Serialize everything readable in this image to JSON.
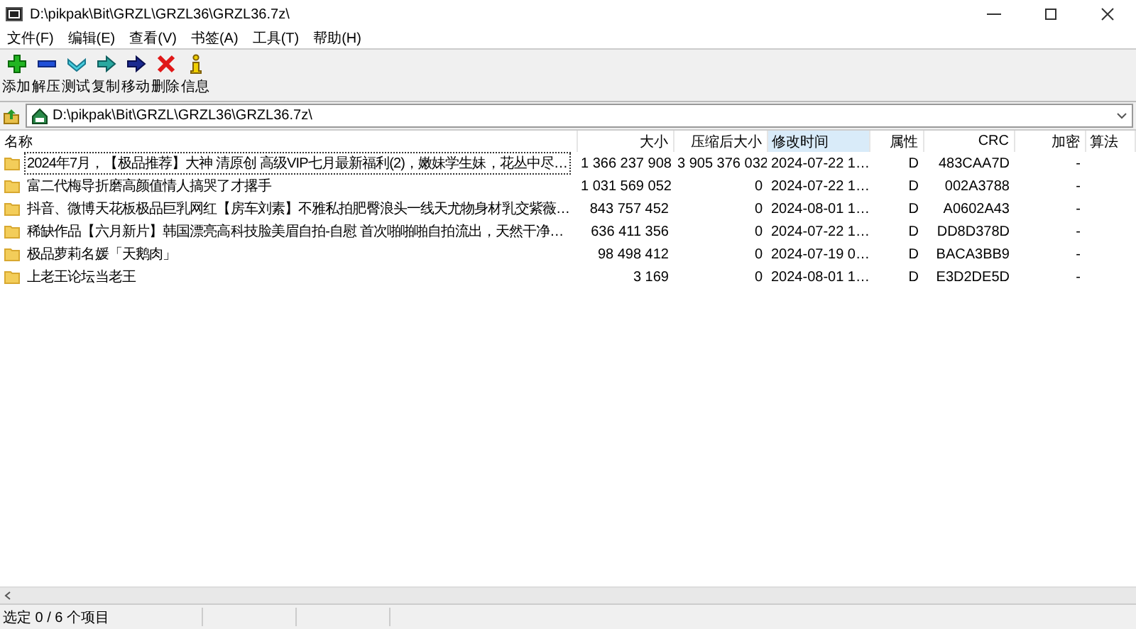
{
  "window": {
    "title": "D:\\pikpak\\Bit\\GRZL\\GRZL36\\GRZL36.7z\\"
  },
  "menu": [
    "文件(F)",
    "编辑(E)",
    "查看(V)",
    "书签(A)",
    "工具(T)",
    "帮助(H)"
  ],
  "toolbar": [
    {
      "kind": "add",
      "label": "添加"
    },
    {
      "kind": "extract",
      "label": "解压"
    },
    {
      "kind": "test",
      "label": "测试"
    },
    {
      "kind": "copy",
      "label": "复制"
    },
    {
      "kind": "move",
      "label": "移动"
    },
    {
      "kind": "delete",
      "label": "删除"
    },
    {
      "kind": "info",
      "label": "信息"
    }
  ],
  "address": {
    "path": "D:\\pikpak\\Bit\\GRZL\\GRZL36\\GRZL36.7z\\"
  },
  "table": {
    "columns": [
      {
        "label": "名称",
        "sorted": false
      },
      {
        "label": "大小",
        "sorted": false
      },
      {
        "label": "压缩后大小",
        "sorted": false
      },
      {
        "label": "修改时间",
        "sorted": true
      },
      {
        "label": "属性",
        "sorted": false
      },
      {
        "label": "CRC",
        "sorted": false
      },
      {
        "label": "加密",
        "sorted": false
      },
      {
        "label": "算法",
        "sorted": false
      }
    ],
    "rows": [
      {
        "focused": true,
        "cells": [
          "2024年7月，【极品推荐】大神 清原创 高级VIP七月最新福利(2)，嫩妹学生妹，花丛中尽…",
          "1 366 237 908",
          "3 905 376 032",
          "2024-07-22 1…",
          "D",
          "483CAA7D",
          "-"
        ]
      },
      {
        "focused": false,
        "cells": [
          "富二代梅导折磨高颜值情人搞哭了才撂手",
          "1 031 569 052",
          "0",
          "2024-07-22 1…",
          "D",
          "002A3788",
          "-"
        ]
      },
      {
        "focused": false,
        "cells": [
          "抖音、微博天花板极品巨乳网红【房车刘素】不雅私拍肥臀浪头一线天尤物身材乳交紫薇…",
          "843 757 452",
          "0",
          "2024-08-01 1…",
          "D",
          "A0602A43",
          "-"
        ]
      },
      {
        "focused": false,
        "cells": [
          "稀缺作品【六月新片】韩国漂亮高科技脸美眉自拍-自慰 首次啪啪啪自拍流出，天然干净…",
          "636 411 356",
          "0",
          "2024-07-22 1…",
          "D",
          "DD8D378D",
          "-"
        ]
      },
      {
        "focused": false,
        "cells": [
          "极品萝莉名媛「天鹅肉」",
          "98 498 412",
          "0",
          "2024-07-19 0…",
          "D",
          "BACA3BB9",
          "-"
        ]
      },
      {
        "focused": false,
        "cells": [
          "上老王论坛当老王",
          "3 169",
          "0",
          "2024-08-01 1…",
          "D",
          "E3D2DE5D",
          "-"
        ]
      }
    ]
  },
  "status_bar": {
    "text": "选定 0 / 6 个项目"
  }
}
